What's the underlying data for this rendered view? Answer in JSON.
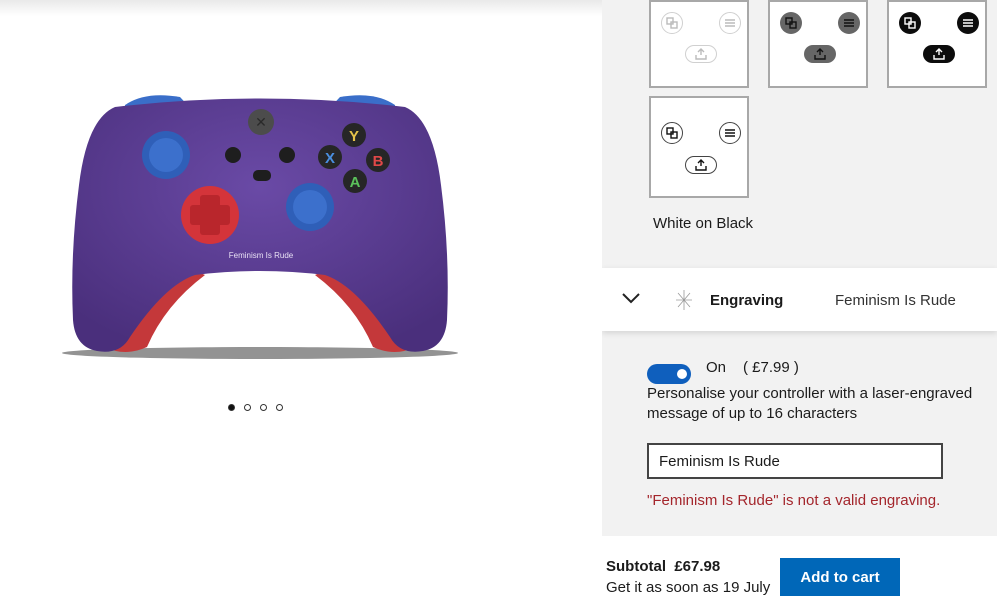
{
  "product": {
    "engraving_preview": "Feminism Is Rude",
    "buttons": {
      "y": "Y",
      "x": "X",
      "b": "B",
      "a": "A"
    },
    "image_count": 4,
    "active_image": 0,
    "colors": {
      "body": "#5b3d94",
      "bumpers": "#3a6ec9",
      "thumbsticks": "#2f5fb8",
      "dpad": "#d4343a",
      "grips": "#c4383a"
    }
  },
  "swatches": {
    "selected_label": "White on Black",
    "styles": [
      "light",
      "grey",
      "dark",
      "outlined"
    ]
  },
  "engraving": {
    "title": "Engraving",
    "current_value": "Feminism Is Rude",
    "toggle_state": "On",
    "toggle_on": true,
    "price": "( £7.99 )",
    "help_text": "Personalise your controller with a laser-engraved message of up to 16 characters",
    "input_value": "Feminism Is Rude",
    "error": "\"Feminism Is Rude\" is not a valid engraving."
  },
  "summary": {
    "subtotal": "Subtotal  £67.98",
    "delivery": "Get it as soon as 19 July"
  },
  "actions": {
    "add_to_cart": "Add to cart"
  },
  "theme": {
    "accent": "#0067b8",
    "toggle": "#0f5fbd",
    "error": "#a4262c",
    "panel_bg": "#f2f2f2"
  }
}
